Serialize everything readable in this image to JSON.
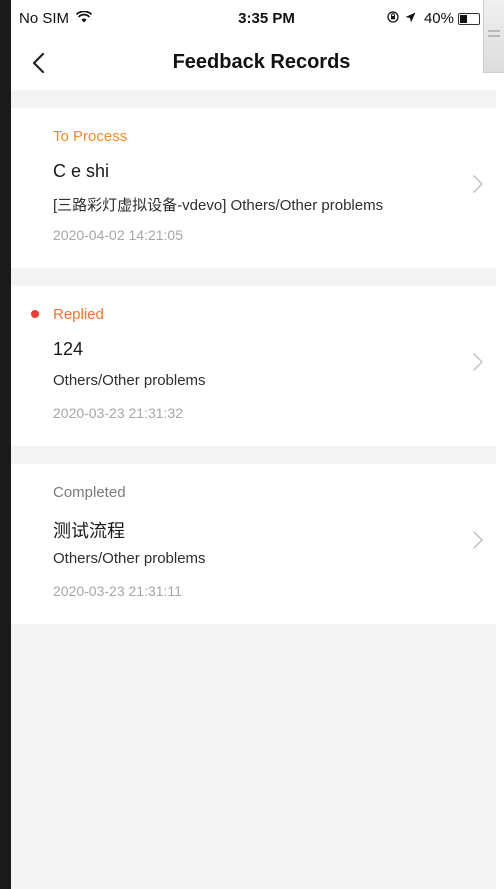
{
  "status_bar": {
    "carrier": "No SIM",
    "time": "3:35 PM",
    "battery": "40%",
    "battery_level": 0.4
  },
  "nav": {
    "title": "Feedback Records"
  },
  "colors": {
    "to_process": "#f58a2a",
    "replied": "#f5762a",
    "replied_dot": "#f23b2f",
    "completed": "#7a7a7a",
    "background": "#f4f4f4",
    "card": "#ffffff"
  },
  "records": [
    {
      "status": "To Process",
      "title": "C e shi",
      "description": "[三路彩灯虚拟设备-vdevo]  Others/Other problems",
      "time": "2020-04-02 14:21:05"
    },
    {
      "status": "Replied",
      "title": "124",
      "description": "Others/Other problems",
      "time": "2020-03-23 21:31:32"
    },
    {
      "status": "Completed",
      "title": "测试流程",
      "description": "Others/Other problems",
      "time": "2020-03-23 21:31:11"
    }
  ]
}
